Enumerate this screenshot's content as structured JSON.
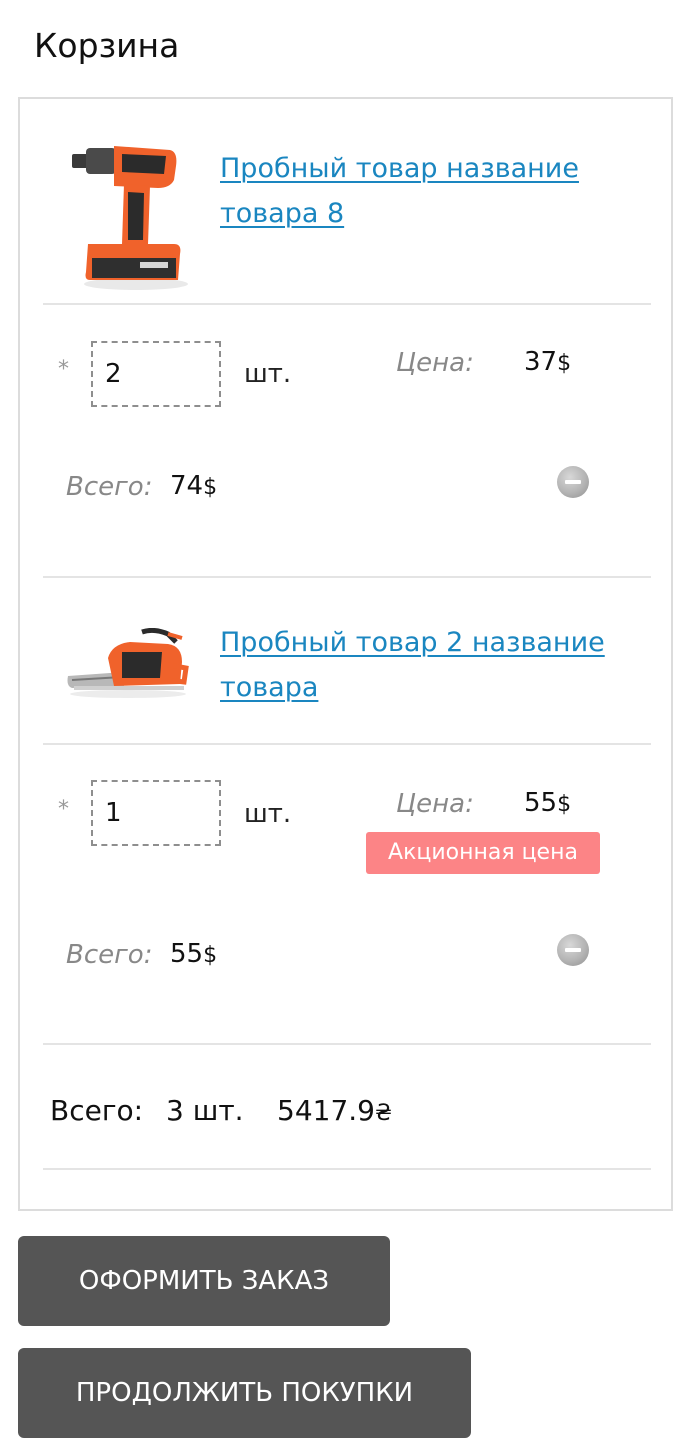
{
  "page": {
    "title": "Корзина"
  },
  "items": [
    {
      "name": "Пробный товар название товара 8",
      "qty": "2",
      "qty_unit": "шт.",
      "price_label": "Цена:",
      "price": "37",
      "total_label": "Всего:",
      "total": "74",
      "currency": "$",
      "image": "cordless-drill"
    },
    {
      "name": "Пробный товар 2 название товара",
      "qty": "1",
      "qty_unit": "шт.",
      "price_label": "Цена:",
      "price": "55",
      "promo": "Акционная цена",
      "total_label": "Всего:",
      "total": "55",
      "currency": "$",
      "image": "chainsaw"
    }
  ],
  "summary": {
    "label": "Всего:",
    "count": "3 шт.",
    "amount": "5417.9",
    "currency": "₴"
  },
  "buttons": {
    "checkout": "Оформить заказ",
    "continue": "Продолжить покупки"
  },
  "required_mark": "*",
  "colors": {
    "link": "#1a86c0",
    "button_bg": "#555555",
    "promo_bg": "#fc8486",
    "border": "#dcdcdc"
  }
}
